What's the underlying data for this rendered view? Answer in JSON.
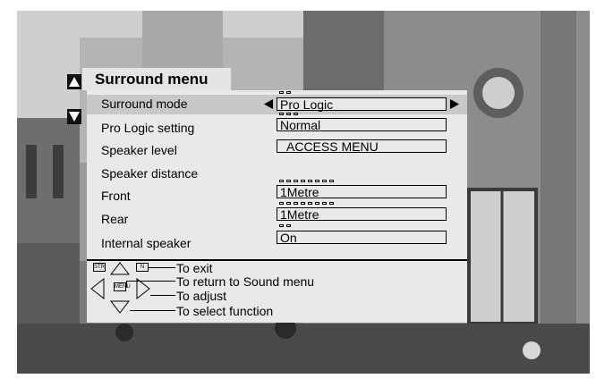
{
  "menu": {
    "title": "Surround menu",
    "rows": [
      {
        "label": "Surround mode",
        "value": "Pro Logic",
        "dots": 2
      },
      {
        "label": "Pro Logic setting",
        "value": "Normal",
        "dots": 3
      },
      {
        "label": "Speaker level",
        "value": "ACCESS MENU",
        "dots": 0
      },
      {
        "label": "Speaker distance",
        "value": "",
        "dots": 0
      },
      {
        "label": "Front",
        "value": "1Metre",
        "dots": 8
      },
      {
        "label": "Rear",
        "value": "1Metre",
        "dots": 8
      },
      {
        "label": "Internal speaker",
        "value": "On",
        "dots": 2
      }
    ]
  },
  "help": {
    "exit": "To exit",
    "return": "To return to Sound menu",
    "adjust": "To adjust",
    "select": "To select function",
    "key_str": "STR",
    "key_menu": "MENU",
    "key_n": "N"
  },
  "colors": {
    "panel": "#e9e9e9",
    "highlight": "#c8c8c8",
    "title_bg": "#e4e4e4"
  },
  "icons": [
    "up-arrow-icon",
    "down-arrow-icon",
    "left-arrow-icon",
    "right-arrow-icon"
  ]
}
